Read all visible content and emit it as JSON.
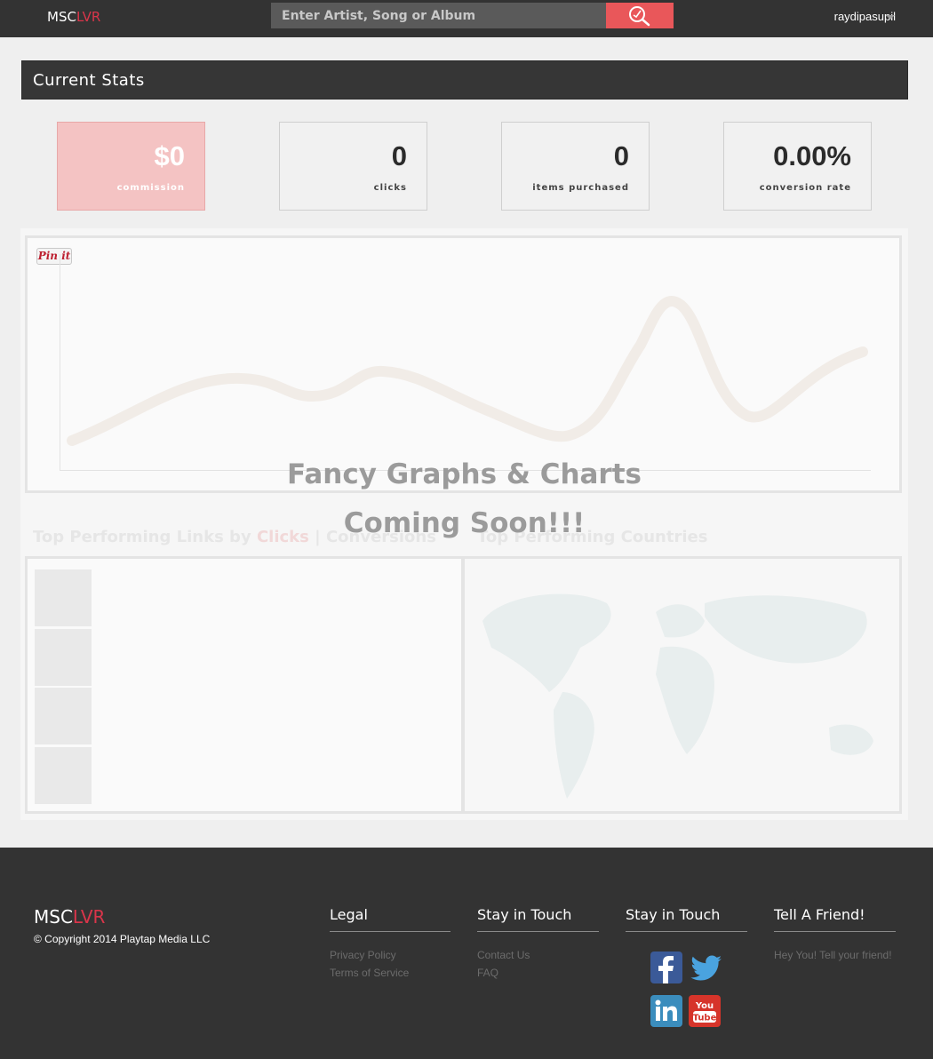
{
  "header": {
    "logo_part1": "MSC",
    "logo_part2": "LVR",
    "search_placeholder": "Enter Artist, Song or Album",
    "username": "raydipasupil"
  },
  "stats": {
    "title": "Current Stats",
    "items": [
      {
        "value": "$0",
        "label": "commission"
      },
      {
        "value": "0",
        "label": "clicks"
      },
      {
        "value": "0",
        "label": "items purchased"
      },
      {
        "value": "0.00%",
        "label": "conversion rate"
      }
    ]
  },
  "overlay": {
    "line1": "Fancy Graphs & Charts",
    "line2": "Coming Soon!!!"
  },
  "pinit_label": "Pin it",
  "sections": {
    "links_prefix": "Top Performing Links by ",
    "links_clicks": "Clicks",
    "links_sep": " | ",
    "links_conversions": "Conversions",
    "countries": "Top Performing Countries"
  },
  "footer": {
    "logo_part1": "MSC",
    "logo_part2": "LVR",
    "copyright": "© Copyright 2014 Playtap Media LLC",
    "legal": {
      "title": "Legal",
      "links": [
        "Privacy Policy",
        "Terms of Service"
      ]
    },
    "touch1": {
      "title": "Stay in Touch",
      "links": [
        "Contact Us",
        "FAQ"
      ]
    },
    "touch2": {
      "title": "Stay in Touch"
    },
    "friend": {
      "title": "Tell A Friend!",
      "text": "Hey You! Tell your friend!"
    },
    "social_icons": [
      "facebook-icon",
      "twitter-icon",
      "linkedin-icon",
      "youtube-icon"
    ]
  },
  "colors": {
    "accent": "#d9354a",
    "search_button": "#e9575a",
    "topbar": "#333333",
    "commission_box": "#f4c3c3"
  }
}
